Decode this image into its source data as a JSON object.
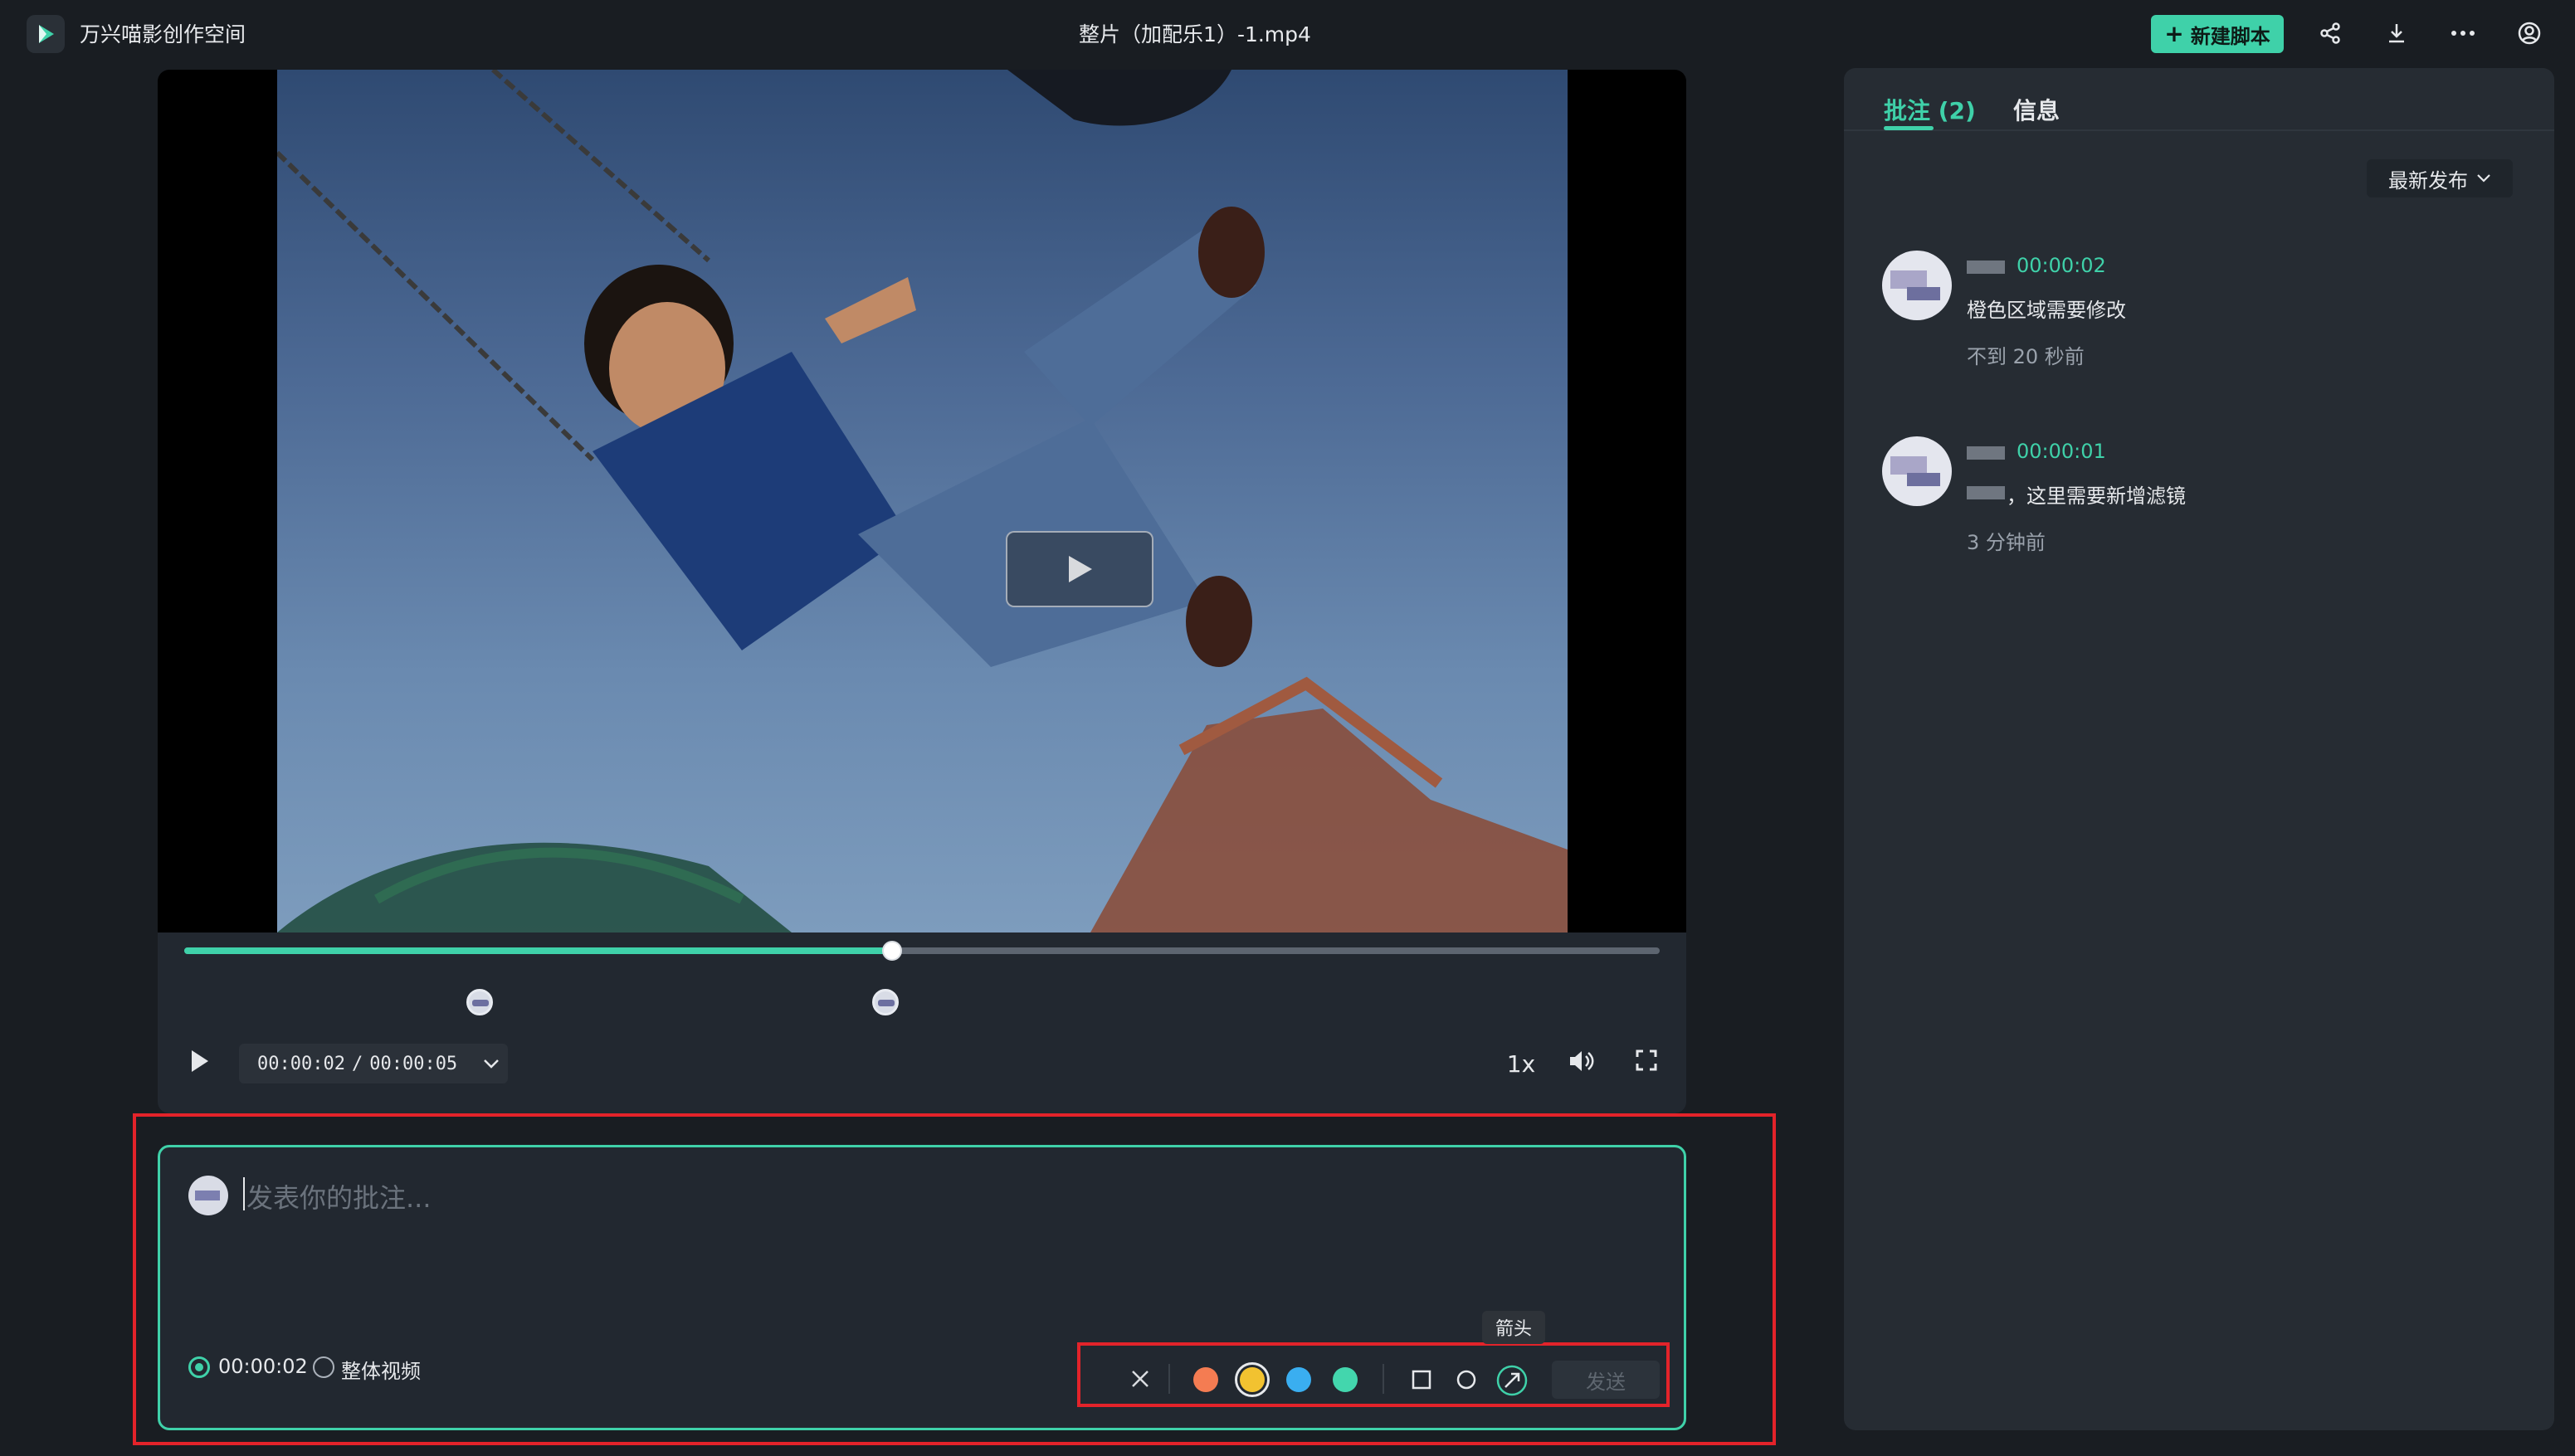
{
  "app": {
    "title": "万兴喵影创作空间"
  },
  "file": {
    "title": "整片（加配乐1）-1.mp4"
  },
  "header": {
    "new_script": "新建脚本"
  },
  "player": {
    "current_time": "00:00:02",
    "time_sep": "/",
    "total_time": "00:00:05",
    "speed": "1x",
    "progress": 0.48,
    "markers_progress": [
      0.2,
      0.475
    ]
  },
  "comment_input": {
    "placeholder": "发表你的批注...",
    "option_timestamp": "00:00:02",
    "option_whole": "整体视频",
    "tooltip": "箭头",
    "send": "发送",
    "colors": [
      "#f47c52",
      "#f2c230",
      "#3aaef0",
      "#43d6ad"
    ]
  },
  "sidebar": {
    "tab_comments": "批注 (2)",
    "tab_info": "信息",
    "sort_label": "最新发布",
    "comments": [
      {
        "timestamp": "00:00:02",
        "text": "橙色区域需要修改",
        "time_ago": "不到 20 秒前"
      },
      {
        "timestamp": "00:00:01",
        "text": "，这里需要新增滤镜",
        "time_ago": "3 分钟前"
      }
    ]
  }
}
